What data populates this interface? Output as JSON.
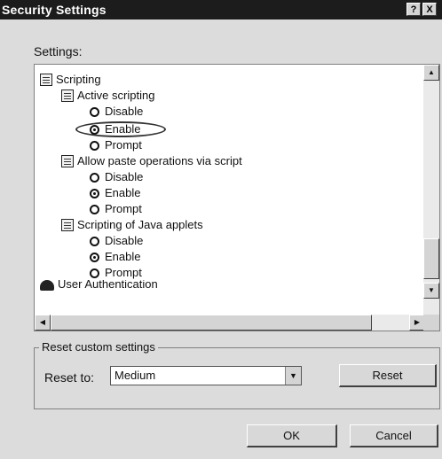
{
  "window": {
    "title": "Security Settings",
    "help_glyph": "?",
    "close_glyph": "X"
  },
  "settings_label": "Settings:",
  "tree": {
    "root": "Scripting",
    "groups": [
      {
        "label": "Active scripting",
        "options": [
          {
            "label": "Disable",
            "checked": false
          },
          {
            "label": "Enable",
            "checked": true
          },
          {
            "label": "Prompt",
            "checked": false
          }
        ]
      },
      {
        "label": "Allow paste operations via script",
        "options": [
          {
            "label": "Disable",
            "checked": false
          },
          {
            "label": "Enable",
            "checked": true
          },
          {
            "label": "Prompt",
            "checked": false
          }
        ]
      },
      {
        "label": "Scripting of Java applets",
        "options": [
          {
            "label": "Disable",
            "checked": false
          },
          {
            "label": "Enable",
            "checked": true
          },
          {
            "label": "Prompt",
            "checked": false
          }
        ]
      }
    ],
    "next_root": "User Authentication"
  },
  "reset": {
    "group_label": "Reset custom settings",
    "label": "Reset to:",
    "value": "Medium",
    "button": "Reset"
  },
  "buttons": {
    "ok": "OK",
    "cancel": "Cancel"
  }
}
